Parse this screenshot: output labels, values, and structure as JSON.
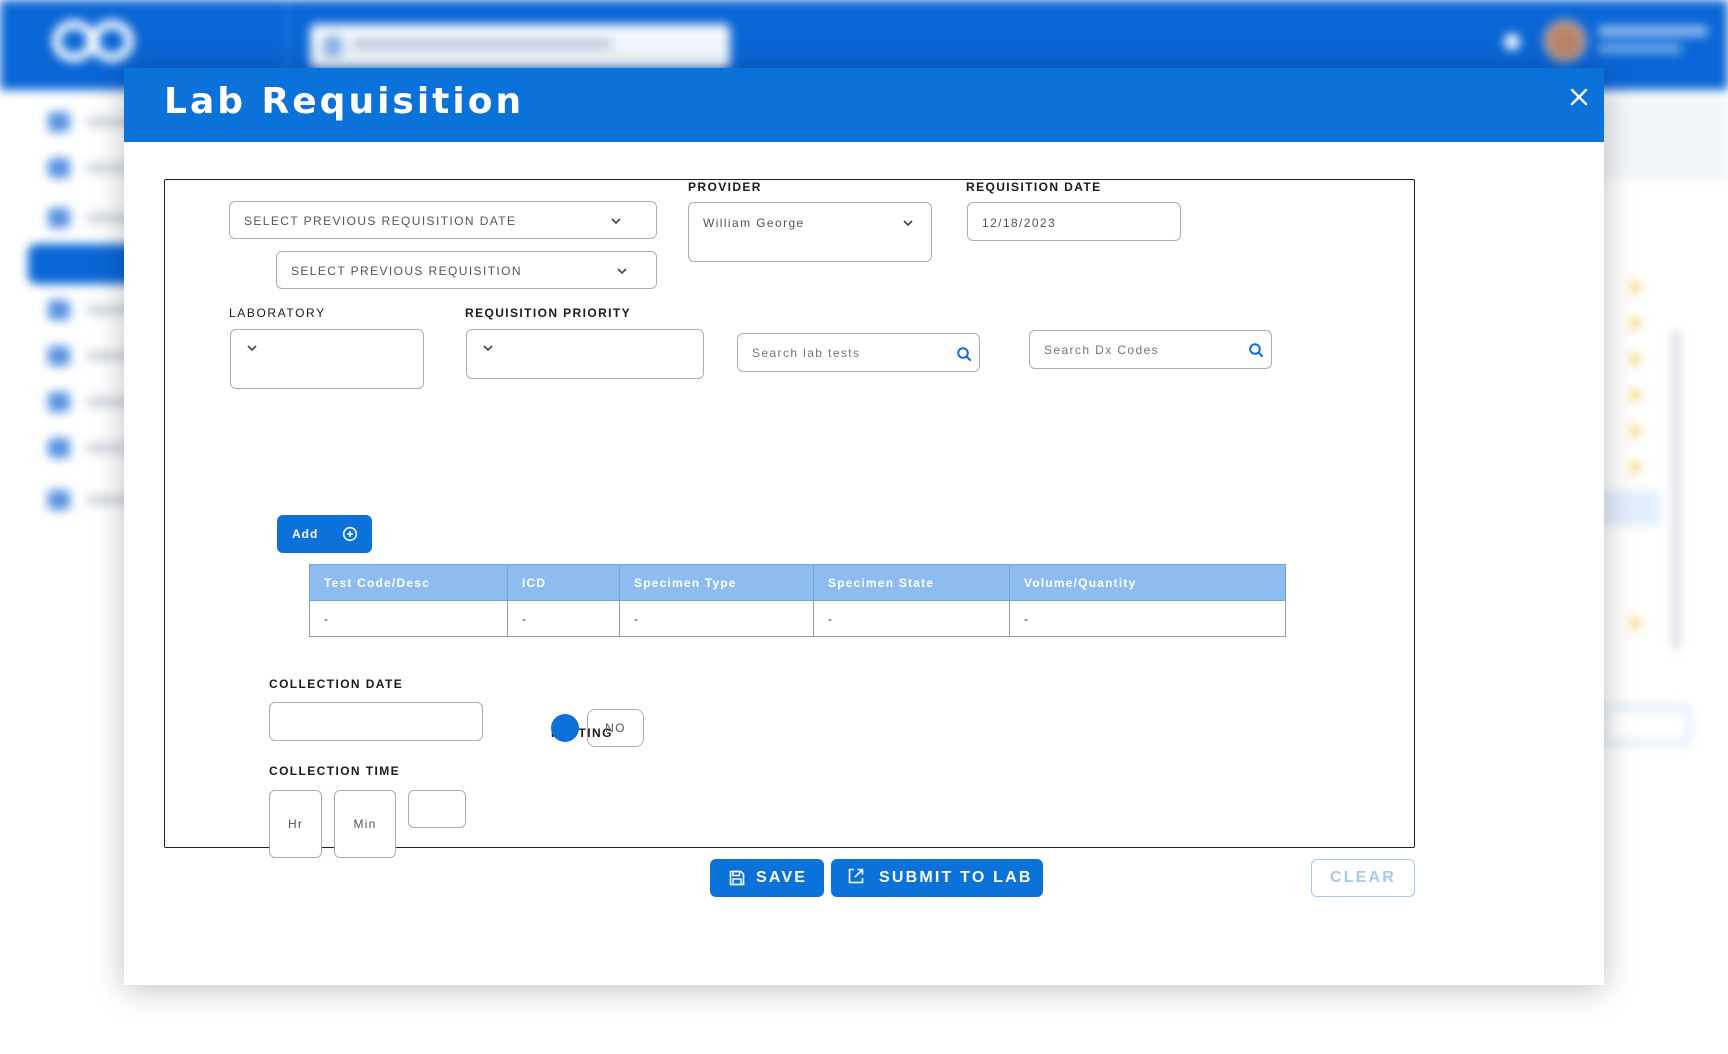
{
  "modal": {
    "title": "Lab Requisition"
  },
  "form": {
    "prev_requisition_date": {
      "label": "SELECT PREVIOUS REQUISITION DATE"
    },
    "prev_requisition": {
      "label": "SELECT PREVIOUS REQUISITION"
    },
    "provider": {
      "label": "PROVIDER",
      "value": "William George"
    },
    "requisition_date": {
      "label": "REQUISITION DATE",
      "value": "12/18/2023"
    },
    "laboratory": {
      "label": "LABORATORY",
      "value": ""
    },
    "requisition_priority": {
      "label": "REQUISITION PRIORITY",
      "value": ""
    },
    "search_lab_tests": {
      "placeholder": "Search lab tests"
    },
    "search_dx_codes": {
      "placeholder": "Search Dx Codes"
    },
    "add_button": {
      "label": "Add"
    },
    "tests_table": {
      "columns": [
        "Test Code/Desc",
        "ICD",
        "Specimen Type",
        "Specimen State",
        "Volume/Quantity"
      ],
      "rows": [
        [
          "-",
          "-",
          "-",
          "-",
          "-"
        ]
      ]
    },
    "collection_date": {
      "label": "COLLECTION DATE",
      "value": ""
    },
    "collection_time": {
      "label": "COLLECTION TIME",
      "hr": "Hr",
      "min": "Min",
      "ampm": ""
    },
    "fasting": {
      "label": "FASTING",
      "option_no": "NO",
      "selected": "yes-dot"
    }
  },
  "actions": {
    "save_label": "SAVE",
    "submit_label": "SUBMIT TO LAB",
    "clear_label": "CLEAR"
  },
  "colors": {
    "primary": "#0a72d8",
    "table_header": "#8fbcee",
    "clear_outline": "#a7c8f1"
  }
}
